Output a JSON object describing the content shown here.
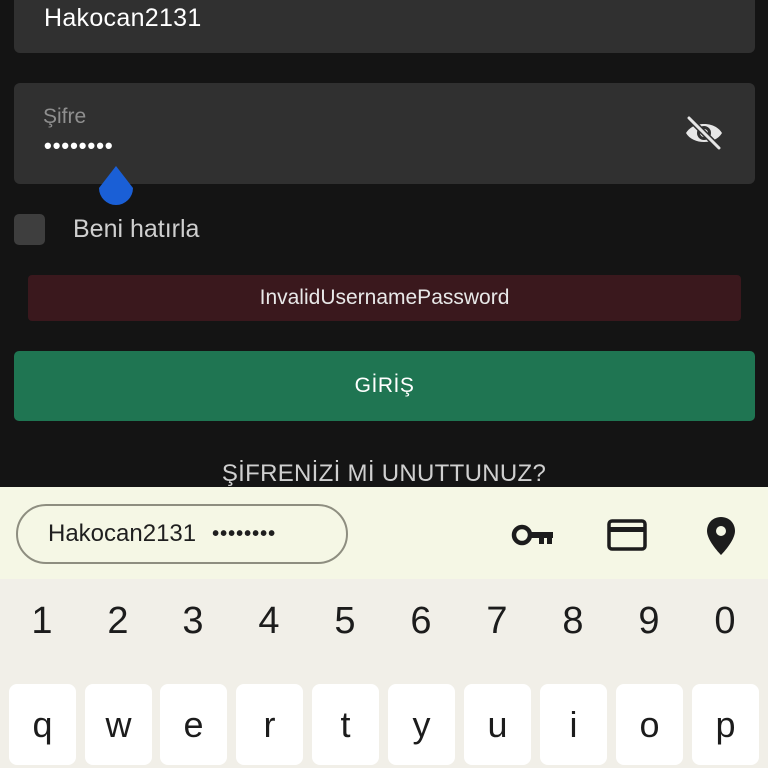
{
  "login": {
    "username_value": "Hakocan2131",
    "password_label": "Şifre",
    "password_value": "••••••••",
    "remember_label": "Beni hatırla",
    "error_message": "InvalidUsernamePassword",
    "login_button": "GİRİŞ",
    "forgot_password": "ŞİFRENİZİ Mİ UNUTTUNUZ?"
  },
  "keyboard": {
    "suggestion_username": "Hakocan2131",
    "suggestion_password": "••••••••",
    "suggestion_icons": [
      "key-icon",
      "credit-card-icon",
      "location-pin-icon"
    ],
    "numbers": [
      "1",
      "2",
      "3",
      "4",
      "5",
      "6",
      "7",
      "8",
      "9",
      "0"
    ],
    "letters": [
      "q",
      "w",
      "e",
      "r",
      "t",
      "y",
      "u",
      "i",
      "o",
      "p"
    ]
  },
  "colors": {
    "background": "#141414",
    "field": "#303030",
    "error_bg": "#3a181d",
    "login_button": "#1f7552",
    "cursor_handle": "#1a5fd6",
    "keyboard_bg": "#f1efe8"
  }
}
